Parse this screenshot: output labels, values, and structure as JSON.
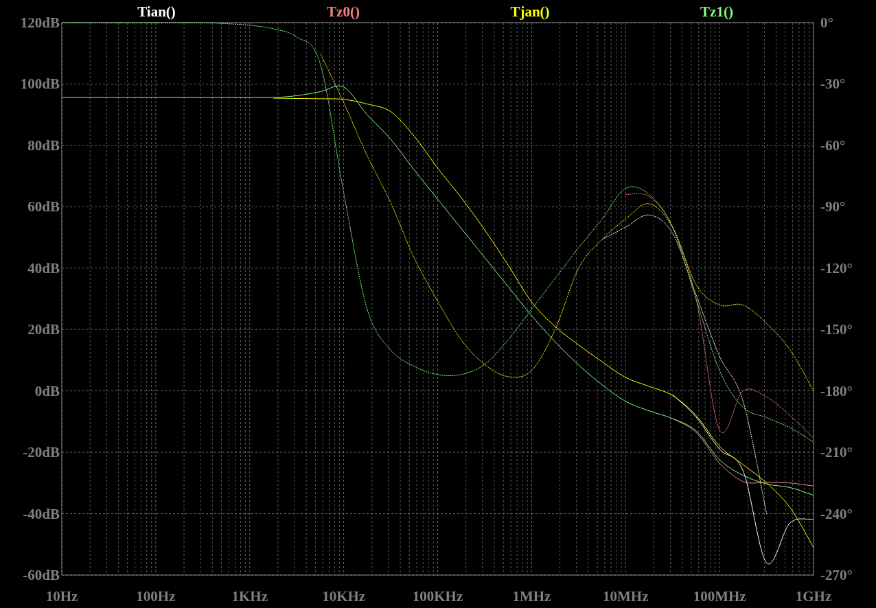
{
  "chart_data": {
    "type": "line",
    "grid": true,
    "ylim": [
      -60,
      120
    ],
    "y2lim": [
      -270,
      0
    ],
    "categories": [
      "10Hz",
      null,
      null,
      null,
      "100Hz",
      null,
      null,
      null,
      "1KHz",
      null,
      null,
      null,
      "10KHz",
      null,
      null,
      null,
      "100KHz",
      null,
      null,
      null,
      "1MHz",
      null,
      null,
      null,
      "10MHz",
      null,
      null,
      null,
      "100MHz",
      null,
      null,
      null,
      "1GHz"
    ],
    "yticks": [
      {
        "value": 120,
        "label": "120dB"
      },
      {
        "value": 100,
        "label": "100dB"
      },
      {
        "value": 80,
        "label": "80dB"
      },
      {
        "value": 60,
        "label": "60dB"
      },
      {
        "value": 40,
        "label": "40dB"
      },
      {
        "value": 20,
        "label": "20dB"
      },
      {
        "value": 0,
        "label": "0dB"
      },
      {
        "value": -20,
        "label": "-20dB"
      },
      {
        "value": -40,
        "label": "-40dB"
      },
      {
        "value": -60,
        "label": "-60dB"
      }
    ],
    "y2ticks": [
      {
        "value": 0,
        "label": "0°"
      },
      {
        "value": -30,
        "label": "-30°"
      },
      {
        "value": -60,
        "label": "-60°"
      },
      {
        "value": -90,
        "label": "-90°"
      },
      {
        "value": -120,
        "label": "-120°"
      },
      {
        "value": -150,
        "label": "-150°"
      },
      {
        "value": -180,
        "label": "-180°"
      },
      {
        "value": -210,
        "label": "-210°"
      },
      {
        "value": -240,
        "label": "-240°"
      },
      {
        "value": -270,
        "label": "-270°"
      }
    ],
    "series": [
      {
        "name": "Tian()",
        "color": "#ffffff",
        "values": [
          null,
          null,
          null,
          null,
          null,
          null,
          null,
          null,
          null,
          null,
          null,
          null,
          null,
          null,
          null,
          null,
          null,
          null,
          null,
          null,
          null,
          null,
          null,
          null,
          null,
          null,
          -1.2,
          -8.5,
          -19,
          -26,
          -56,
          -43,
          -42
        ]
      },
      {
        "name": "Tz0()",
        "color": "#ff8080",
        "values": [
          null,
          null,
          null,
          null,
          null,
          null,
          null,
          null,
          null,
          null,
          null,
          null,
          null,
          null,
          null,
          null,
          null,
          null,
          null,
          null,
          null,
          null,
          null,
          null,
          null,
          null,
          -9,
          -13.5,
          -23.5,
          -29.5,
          -29.8,
          -30,
          -31
        ]
      },
      {
        "name": "Tjan()",
        "color": "#ffff00",
        "values": [
          null,
          null,
          null,
          null,
          null,
          null,
          null,
          null,
          null,
          95.4,
          95.3,
          95.2,
          95,
          93.5,
          91,
          83,
          72.6,
          63,
          52.5,
          41,
          29,
          21,
          15,
          9.5,
          4.4,
          1.5,
          -1.5,
          -8,
          -18,
          -24,
          -30,
          -38,
          -51
        ]
      },
      {
        "name": "Tz1()",
        "color": "#80ff80",
        "values": [
          95.6,
          95.6,
          95.6,
          95.6,
          95.6,
          95.6,
          95.6,
          95.6,
          95.6,
          95.6,
          96.2,
          97.5,
          99,
          90,
          82,
          72,
          62.5,
          53,
          43.5,
          34,
          24.5,
          16,
          8.5,
          2,
          -3.4,
          -6.5,
          -9,
          -13,
          -22.4,
          -27.5,
          -30.3,
          -31.5,
          -34
        ]
      },
      {
        "color": "#ffffff",
        "axis": "y2",
        "line_style": "dashed",
        "values": [
          null,
          null,
          null,
          null,
          null,
          null,
          null,
          null,
          null,
          null,
          null,
          null,
          null,
          null,
          null,
          null,
          null,
          null,
          null,
          null,
          null,
          null,
          null,
          -106,
          -100,
          -94,
          -103,
          -133,
          -163,
          -185,
          -240,
          null,
          null
        ]
      },
      {
        "color": "#ff8080",
        "axis": "y2",
        "line_style": "dashed",
        "values": [
          null,
          null,
          null,
          null,
          null,
          null,
          null,
          null,
          null,
          null,
          null,
          null,
          null,
          null,
          null,
          null,
          null,
          null,
          null,
          null,
          null,
          null,
          null,
          null,
          -84,
          -85,
          -100,
          -135,
          -199,
          -180,
          -183,
          -192,
          -203
        ]
      },
      {
        "color": "#ffff00",
        "axis": "y2",
        "line_style": "dashed",
        "values": [
          null,
          null,
          null,
          null,
          null,
          null,
          null,
          null,
          null,
          null,
          null,
          -15,
          -39,
          -65,
          -88,
          -115,
          -136,
          -155,
          -167,
          -173,
          -170,
          -150,
          -120,
          -106,
          -96,
          -88.5,
          -100,
          -128,
          -138,
          -138,
          -147,
          -160,
          -180
        ]
      },
      {
        "color": "#80ff80",
        "axis": "y2",
        "line_style": "dashed",
        "values": [
          0,
          0,
          0,
          0,
          0,
          0,
          0,
          -0.5,
          -1.3,
          -3,
          -7,
          -20,
          -83,
          -140,
          -160,
          -168,
          -172,
          -172,
          -167,
          -155,
          -140,
          -125,
          -110,
          -96,
          -81,
          -84,
          -100,
          -135,
          -170,
          -188,
          -193,
          -198,
          -205
        ]
      }
    ]
  }
}
